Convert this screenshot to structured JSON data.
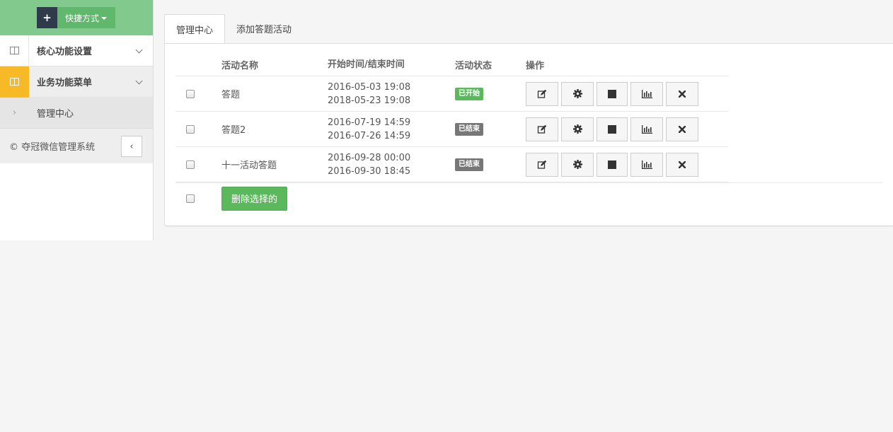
{
  "shortcut": {
    "plus": "+",
    "label": "快捷方式"
  },
  "sidebar": {
    "items": [
      {
        "label": "核心功能设置"
      },
      {
        "label": "业务功能菜单"
      }
    ],
    "sub_items": [
      {
        "label": "管理中心"
      }
    ],
    "footer": "© 夺冠微信管理系统",
    "collapse": "‹"
  },
  "tabs": [
    {
      "label": "管理中心"
    },
    {
      "label": "添加答题活动"
    }
  ],
  "table": {
    "headers": {
      "name": "活动名称",
      "time": "开始时间/结束时间",
      "status": "活动状态",
      "ops": "操作"
    },
    "rows": [
      {
        "name": "答题",
        "start": "2016-05-03 19:08",
        "end": "2018-05-23 19:08",
        "status": "已开始",
        "status_type": "started"
      },
      {
        "name": "答题2",
        "start": "2016-07-19 14:59",
        "end": "2016-07-26 14:59",
        "status": "已结束",
        "status_type": "ended"
      },
      {
        "name": "十一活动答题",
        "start": "2016-09-28 00:00",
        "end": "2016-09-30 18:45",
        "status": "已结束",
        "status_type": "ended"
      }
    ],
    "row_actions": [
      "edit-icon",
      "gear-icon",
      "stop-icon",
      "chart-icon",
      "delete-icon"
    ],
    "delete_selected": "删除选择的"
  },
  "colors": {
    "accent": "#5cb85c",
    "sidebar_header": "#82c98e",
    "active_menu": "#f7b926",
    "ended": "#777777"
  }
}
